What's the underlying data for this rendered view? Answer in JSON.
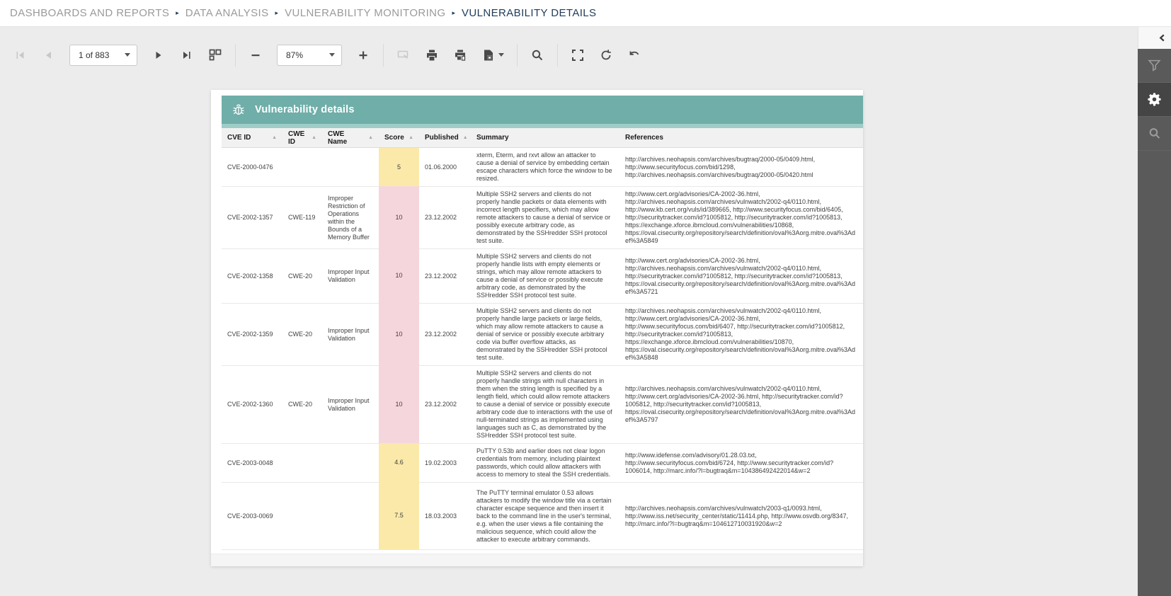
{
  "breadcrumb": {
    "items": [
      "DASHBOARDS AND REPORTS",
      "DATA ANALYSIS",
      "VULNERABILITY MONITORING",
      "VULNERABILITY DETAILS"
    ]
  },
  "icons": {
    "breadcrumb_separator": "▸",
    "sort_ascending": "▲",
    "collapse_panel": "chevron-left",
    "filter_panel": "funnel",
    "settings_panel": "gear",
    "search_panel": "magnifier",
    "report_title": "bug"
  },
  "toolbar": {
    "page_selector": "1 of 883",
    "zoom_level": "87%"
  },
  "colors": {
    "accent_teal": "#6FAEA9",
    "accent_teal_light": "#9ECDC8",
    "score_yellow": "#FAE9A9",
    "score_pink": "#F6D6DD",
    "sidebar_dark": "#5A5A5A",
    "sidebar_active": "#454545",
    "breadcrumb_active": "#1E3B5C"
  },
  "report": {
    "title": "Vulnerability details",
    "columns": [
      {
        "label": "CVE ID",
        "sortable": true
      },
      {
        "label": "CWE ID",
        "sortable": true
      },
      {
        "label": "CWE Name",
        "sortable": true
      },
      {
        "label": "Score",
        "sortable": true
      },
      {
        "label": "Published",
        "sortable": true
      },
      {
        "label": "Summary",
        "sortable": false
      },
      {
        "label": "References",
        "sortable": false
      }
    ],
    "rows": [
      {
        "cve": "CVE-2000-0476",
        "cwe_id": "",
        "cwe_name": "",
        "score": "5",
        "score_color": "#FAE9A9",
        "published": "01.06.2000",
        "summary": "xterm, Eterm, and rxvt allow an attacker to cause a denial of service by embedding certain escape characters which force the window to be resized.",
        "references": "http://archives.neohapsis.com/archives/bugtraq/2000-05/0409.html, http://www.securityfocus.com/bid/1298, http://archives.neohapsis.com/archives/bugtraq/2000-05/0420.html"
      },
      {
        "cve": "CVE-2002-1357",
        "cwe_id": "CWE-119",
        "cwe_name": "Improper Restriction of Operations within the Bounds of a Memory Buffer",
        "score": "10",
        "score_color": "#F6D6DD",
        "published": "23.12.2002",
        "summary": "Multiple SSH2 servers and clients do not properly handle packets or data elements with incorrect length specifiers, which may allow remote attackers to cause a denial of service or possibly execute arbitrary code, as demonstrated by the SSHredder SSH protocol test suite.",
        "references": "http://www.cert.org/advisories/CA-2002-36.html, http://archives.neohapsis.com/archives/vulnwatch/2002-q4/0110.html, http://www.kb.cert.org/vuls/id/389665, http://www.securityfocus.com/bid/6405, http://securitytracker.com/id?1005812, http://securitytracker.com/id?1005813, https://exchange.xforce.ibmcloud.com/vulnerabilities/10868, https://oval.cisecurity.org/repository/search/definition/oval%3Aorg.mitre.oval%3Adef%3A5849"
      },
      {
        "cve": "CVE-2002-1358",
        "cwe_id": "CWE-20",
        "cwe_name": "Improper Input Validation",
        "score": "10",
        "score_color": "#F6D6DD",
        "published": "23.12.2002",
        "summary": "Multiple SSH2 servers and clients do not properly handle lists with empty elements or strings, which may allow remote attackers to cause a denial of service or possibly execute arbitrary code, as demonstrated by the SSHredder SSH protocol test suite.",
        "references": "http://www.cert.org/advisories/CA-2002-36.html, http://archives.neohapsis.com/archives/vulnwatch/2002-q4/0110.html, http://securitytracker.com/id?1005812, http://securitytracker.com/id?1005813, https://oval.cisecurity.org/repository/search/definition/oval%3Aorg.mitre.oval%3Adef%3A5721"
      },
      {
        "cve": "CVE-2002-1359",
        "cwe_id": "CWE-20",
        "cwe_name": "Improper Input Validation",
        "score": "10",
        "score_color": "#F6D6DD",
        "published": "23.12.2002",
        "summary": "Multiple SSH2 servers and clients do not properly handle large packets or large fields, which may allow remote attackers to cause a denial of service or possibly execute arbitrary code via buffer overflow attacks, as demonstrated by the SSHredder SSH protocol test suite.",
        "references": "http://archives.neohapsis.com/archives/vulnwatch/2002-q4/0110.html, http://www.cert.org/advisories/CA-2002-36.html, http://www.securityfocus.com/bid/6407, http://securitytracker.com/id?1005812, http://securitytracker.com/id?1005813, https://exchange.xforce.ibmcloud.com/vulnerabilities/10870, https://oval.cisecurity.org/repository/search/definition/oval%3Aorg.mitre.oval%3Adef%3A5848"
      },
      {
        "cve": "CVE-2002-1360",
        "cwe_id": "CWE-20",
        "cwe_name": "Improper Input Validation",
        "score": "10",
        "score_color": "#F6D6DD",
        "published": "23.12.2002",
        "summary": "Multiple SSH2 servers and clients do not properly handle strings with null characters in them when the string length is specified by a length field, which could allow remote attackers to cause a denial of service or possibly execute arbitrary code due to interactions with the use of null-terminated strings as implemented using languages such as C, as demonstrated by the SSHredder SSH protocol test suite.",
        "references": "http://archives.neohapsis.com/archives/vulnwatch/2002-q4/0110.html, http://www.cert.org/advisories/CA-2002-36.html, http://securitytracker.com/id?1005812, http://securitytracker.com/id?1005813, https://oval.cisecurity.org/repository/search/definition/oval%3Aorg.mitre.oval%3Adef%3A5797"
      },
      {
        "cve": "CVE-2003-0048",
        "cwe_id": "",
        "cwe_name": "",
        "score": "4.6",
        "score_color": "#FAE9A9",
        "published": "19.02.2003",
        "summary": "PuTTY 0.53b and earlier does not clear logon credentials from memory, including plaintext passwords, which could allow attackers with access to memory to steal the SSH credentials.",
        "references": "http://www.idefense.com/advisory/01.28.03.txt, http://www.securityfocus.com/bid/6724, http://www.securitytracker.com/id?1006014, http://marc.info/?l=bugtraq&m=104386492422014&w=2"
      },
      {
        "cve": "CVE-2003-0069",
        "cwe_id": "",
        "cwe_name": "",
        "score": "7.5",
        "score_color": "#FAE9A9",
        "published": "18.03.2003",
        "summary": "The PuTTY terminal emulator 0.53 allows attackers to modify the window title via a certain character escape sequence and then insert it back to the command line in the user's terminal, e.g. when the user views a file containing the malicious sequence, which could allow the attacker to execute arbitrary commands.",
        "references": "http://archives.neohapsis.com/archives/vulnwatch/2003-q1/0093.html, http://www.iss.net/security_center/static/11414.php, http://www.osvdb.org/8347, http://marc.info/?l=bugtraq&m=104612710031920&w=2"
      }
    ]
  }
}
